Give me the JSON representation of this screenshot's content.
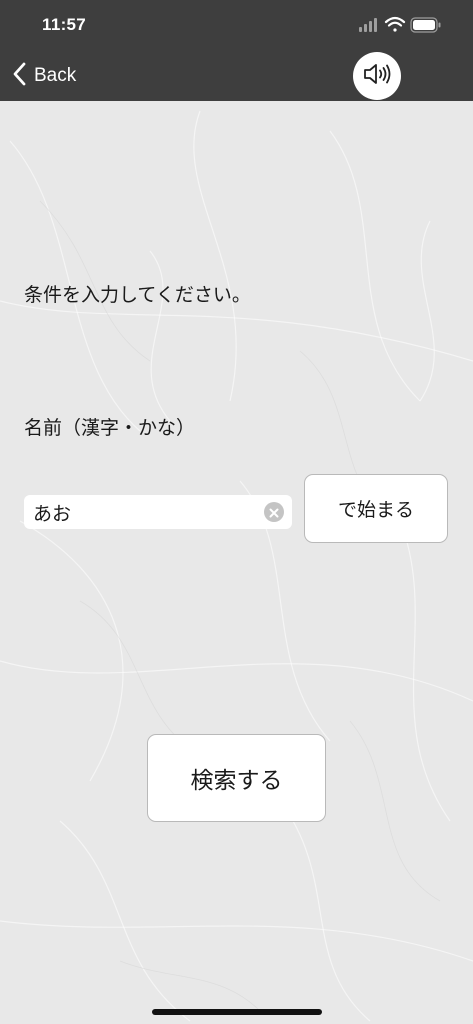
{
  "status_bar": {
    "time": "11:57"
  },
  "nav": {
    "back_label": "Back"
  },
  "content": {
    "prompt": "条件を入力してください。",
    "name_field_label": "名前（漢字・かな）",
    "name_input_value": "あお",
    "starts_with_button": "で始まる",
    "search_button": "検索する"
  },
  "colors": {
    "bar_background": "#3e3e3e",
    "page_background": "#e8e8e8",
    "button_background": "#ffffff"
  },
  "icons": [
    "back-chevron-icon",
    "speaker-icon",
    "clear-icon",
    "signal-icon",
    "wifi-icon",
    "battery-icon"
  ]
}
